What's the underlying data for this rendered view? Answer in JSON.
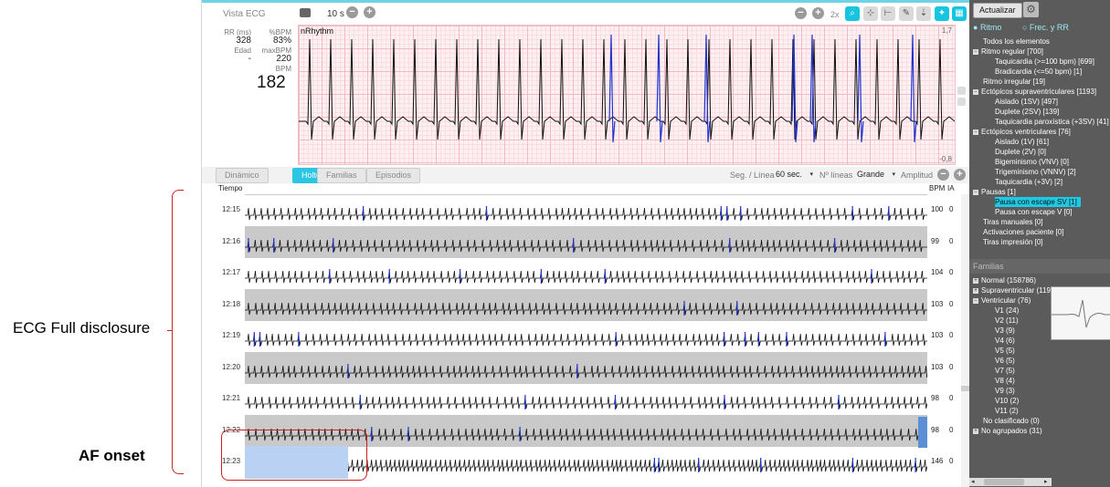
{
  "annotations": {
    "ecg_full_disclosure": "ECG Full disclosure",
    "af_onset": "AF onset"
  },
  "ecg_view": {
    "title": "Vista ECG",
    "seconds": "10 s",
    "zoom": "2x",
    "stats": {
      "rr_label": "RR (ms)",
      "rr_value": "328",
      "edad_label": "Edad",
      "edad_value": "-",
      "pct_bpm_label": "%BPM",
      "pct_bpm_value": "83%",
      "max_bpm_label": "maxBPM",
      "max_bpm_value": "220",
      "bpm_label": "BPM",
      "bpm_value": "182"
    },
    "strip_label": "nRhythm",
    "strip_max": "1,7",
    "strip_min": "-0,8"
  },
  "tabs": [
    {
      "label": "Dinámico",
      "active": false
    },
    {
      "label": "Holter",
      "active": true
    },
    {
      "label": "Familias",
      "active": false
    },
    {
      "label": "Episodios",
      "active": false
    }
  ],
  "controls": {
    "seg_label": "Seg. / Línea",
    "seg_value": "60 sec.",
    "lines_label": "Nº líneas",
    "lines_value": "Grande",
    "amp_label": "Amplitud"
  },
  "disclosure": {
    "time_header": "Tiempo",
    "bpm_header": "BPM",
    "ia_header": "IA",
    "rows": [
      {
        "time": "12:15",
        "bpm": "100",
        "ia": "0",
        "gray": false
      },
      {
        "time": "12:16",
        "bpm": "99",
        "ia": "0",
        "gray": true
      },
      {
        "time": "12:17",
        "bpm": "104",
        "ia": "0",
        "gray": false
      },
      {
        "time": "12:18",
        "bpm": "103",
        "ia": "0",
        "gray": true
      },
      {
        "time": "12:19",
        "bpm": "103",
        "ia": "0",
        "gray": false
      },
      {
        "time": "12:20",
        "bpm": "103",
        "ia": "0",
        "gray": true
      },
      {
        "time": "12:21",
        "bpm": "98",
        "ia": "0",
        "gray": false
      },
      {
        "time": "12:22",
        "bpm": "98",
        "ia": "0",
        "gray": true
      },
      {
        "time": "12:23",
        "bpm": "146",
        "ia": "0",
        "gray": false
      }
    ]
  },
  "side": {
    "refresh": "Actualizar",
    "radio_ritmo": "Ritmo",
    "radio_frec": "Frec. y RR",
    "tree": [
      {
        "label": "Todos los elementos",
        "indent": 1,
        "exp": ""
      },
      {
        "label": "Ritmo regular [700]",
        "indent": 0,
        "exp": "−"
      },
      {
        "label": "Taquicardia (>=100 bpm) [699]",
        "indent": 2,
        "exp": ""
      },
      {
        "label": "Bradicardia (<=50 bpm) [1]",
        "indent": 2,
        "exp": ""
      },
      {
        "label": "Ritmo irregular [19]",
        "indent": 1,
        "exp": ""
      },
      {
        "label": "Ectópicos supraventriculares [1193]",
        "indent": 0,
        "exp": "−"
      },
      {
        "label": "Aislado (1SV) [497]",
        "indent": 2,
        "exp": ""
      },
      {
        "label": "Duplete (2SV) [139]",
        "indent": 2,
        "exp": ""
      },
      {
        "label": "Taquicardia paroxística (+3SV) [41]",
        "indent": 2,
        "exp": ""
      },
      {
        "label": "Ectópicos ventriculares [76]",
        "indent": 0,
        "exp": "−"
      },
      {
        "label": "Aislado (1V) [61]",
        "indent": 2,
        "exp": ""
      },
      {
        "label": "Duplete (2V) [0]",
        "indent": 2,
        "exp": ""
      },
      {
        "label": "Bigeminismo (VNV) [0]",
        "indent": 2,
        "exp": ""
      },
      {
        "label": "Trigeminismo (VNNV) [2]",
        "indent": 2,
        "exp": ""
      },
      {
        "label": "Taquicardia (+3V) [2]",
        "indent": 2,
        "exp": ""
      },
      {
        "label": "Pausas [1]",
        "indent": 0,
        "exp": "−"
      },
      {
        "label": "Pausa con escape SV [1]",
        "indent": 2,
        "exp": "",
        "selected": true
      },
      {
        "label": "Pausa con escape V [0]",
        "indent": 2,
        "exp": ""
      },
      {
        "label": "Tiras manuales [0]",
        "indent": 1,
        "exp": ""
      },
      {
        "label": "Activaciones paciente [0]",
        "indent": 1,
        "exp": ""
      },
      {
        "label": "Tiras impresión [0]",
        "indent": 1,
        "exp": ""
      }
    ],
    "families_header": "Familias",
    "families": [
      {
        "label": "Normal (158786)",
        "indent": 0,
        "exp": "+"
      },
      {
        "label": "Supraventricular (119",
        "indent": 0,
        "exp": "+"
      },
      {
        "label": "Ventricular (76)",
        "indent": 0,
        "exp": "−"
      },
      {
        "label": "V1 (24)",
        "indent": 2,
        "exp": ""
      },
      {
        "label": "V2 (11)",
        "indent": 2,
        "exp": ""
      },
      {
        "label": "V3 (9)",
        "indent": 2,
        "exp": ""
      },
      {
        "label": "V4 (6)",
        "indent": 2,
        "exp": ""
      },
      {
        "label": "V5 (5)",
        "indent": 2,
        "exp": ""
      },
      {
        "label": "V6 (5)",
        "indent": 2,
        "exp": ""
      },
      {
        "label": "V7 (5)",
        "indent": 2,
        "exp": ""
      },
      {
        "label": "V8 (4)",
        "indent": 2,
        "exp": ""
      },
      {
        "label": "V9 (3)",
        "indent": 2,
        "exp": ""
      },
      {
        "label": "V10 (2)",
        "indent": 2,
        "exp": ""
      },
      {
        "label": "V11 (2)",
        "indent": 2,
        "exp": ""
      },
      {
        "label": "No clasificado (0)",
        "indent": 1,
        "exp": ""
      },
      {
        "label": "No agrupados (31)",
        "indent": 0,
        "exp": "+"
      }
    ]
  },
  "colors": {
    "accent": "#2cc6e2",
    "trace": "#111111",
    "ectopic": "#2233cc",
    "annotation_red": "#cc2222"
  }
}
